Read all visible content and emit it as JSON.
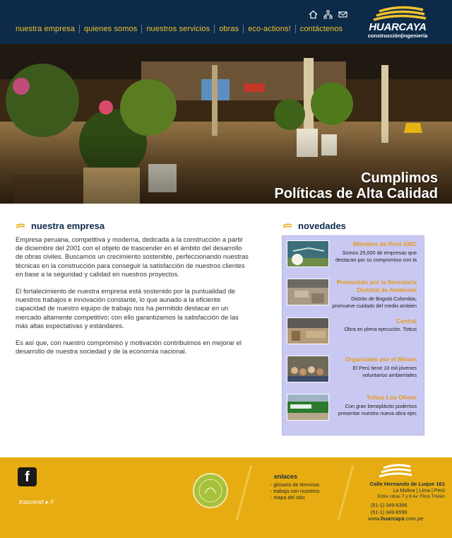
{
  "header": {
    "nav": [
      "nuestra empresa",
      "quienes somos",
      "nuestros servicios",
      "obras",
      "eco-actions!",
      "contáctenos"
    ],
    "icons": [
      "home-icon",
      "sitemap-icon",
      "mail-icon"
    ],
    "logo": {
      "word": "HUARCAYA",
      "sub": "construcción|ingeniería"
    }
  },
  "hero": {
    "line1": "Cumplimos",
    "line2": "Políticas de Alta Calidad"
  },
  "main": {
    "title": "nuestra empresa",
    "paragraphs": [
      "Empresa peruana, competitiva y moderna, dedicada a la construcción a partir de diciembre del 2001 con el objeto de trascender en el ámbito del desarrollo de obras civiles. Buscamos un crecimiento sostenible, perfeccionando nuestras técnicas en la construcción para conseguir la satisfacción de nuestros clientes en base a la seguridad y calidad en nuestros proyectos.",
      "El fortalecimiento de nuestra empresa está sostenido por la puntualidad de nuestros trabajos e innovación constante, lo que aunado a la eficiente capacidad de nuestro equipo de trabajo nos ha permitido destacar en un mercado altamente competitivo; con ello garantizamos la satisfacción de las más altas expectativas y estándares.",
      "Es así que, con nuestro compromiso y motivación contribuimos en mejorar el desarrollo de nuestra sociedad y de la economía nacional."
    ]
  },
  "news": {
    "title": "novedades",
    "items": [
      {
        "head": "Miembro de Perú GBC",
        "desc": "Somos 25,000 de empresas que destacan por su compromiso con la"
      },
      {
        "head": "Promovido por la Secretaría Distrital de Ambiente",
        "desc": "Distrito de Bogotá Colombia, promueve cuidado del medio ambien"
      },
      {
        "head": "Central",
        "desc": "Obra en plena ejecución. Tottus"
      },
      {
        "head": "Organizado por el Minam",
        "desc": "El Perú tiene 10 mil jóvenes voluntarios ambientales"
      },
      {
        "head": "Tottus Los Olivos",
        "desc": "Con gran beneplácito podemos presentar nuestra nueva obra ejec"
      }
    ]
  },
  "footer": {
    "facebook": "f",
    "trascend": "trascend ▸ !!",
    "links_title": "enlaces",
    "links": [
      "- glosario de términos",
      "- trabaja con nosotros",
      "- mapa del sitio"
    ],
    "address_line1": "Calle Hernando de Luque 161",
    "address_line2": "La Molina | Lima | Perú",
    "address_line3": "Entre cdras 7 y 8 Av. Flora Tristán",
    "phone1": "(51-1) 349-6396",
    "phone2": "(51-1) 349-6596",
    "web_prefix": "www.",
    "web_brand": "huarcaya",
    "web_suffix": ".com.pe"
  },
  "colors": {
    "navy": "#0d2b49",
    "gold": "#f3c22e",
    "footer": "#e6ac12",
    "news_bg": "#c9c8f2",
    "news_head": "#e49a18"
  }
}
